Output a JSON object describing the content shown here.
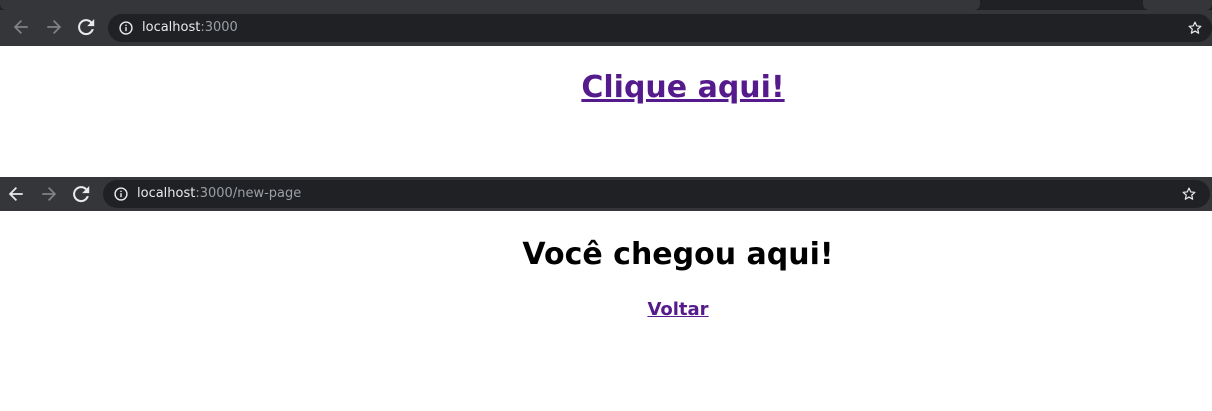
{
  "browser1": {
    "url_host": "localhost",
    "url_rest": ":3000",
    "icons": {
      "back": "back-arrow-icon",
      "forward": "forward-arrow-icon",
      "reload": "reload-icon",
      "info": "info-icon",
      "star": "star-icon"
    }
  },
  "page1": {
    "link_text": "Clique aqui!"
  },
  "browser2": {
    "url_host": "localhost",
    "url_rest": ":3000/new-page"
  },
  "page2": {
    "title": "Você chegou aqui!",
    "link_text": "Voltar"
  },
  "colors": {
    "chrome_dark": "#202124",
    "toolbar": "#35363a",
    "visited_link": "#551a8b"
  }
}
